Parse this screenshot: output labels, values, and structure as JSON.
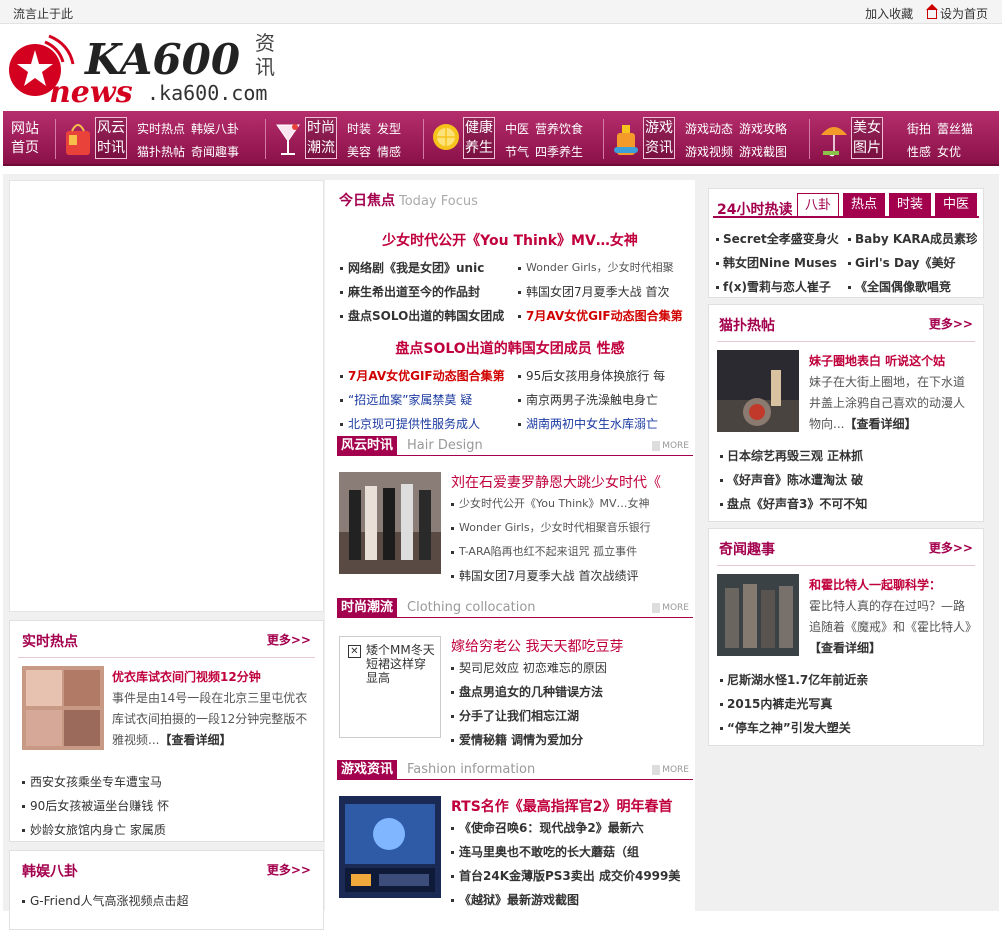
{
  "topbar": {
    "left": "流言止于此",
    "bookmark": "加入收藏",
    "homepage": "设为首页"
  },
  "logo": {
    "brand": "KA600",
    "suffix": "资讯",
    "news": "news",
    "domain": ".ka600.com"
  },
  "nav": {
    "home": "网站首页",
    "cats": [
      {
        "label": "风云时讯",
        "subs": [
          [
            "实时热点",
            "韩娱八卦"
          ],
          [
            "猫扑热帖",
            "奇闻趣事"
          ]
        ]
      },
      {
        "label": "时尚潮流",
        "subs": [
          [
            "时装",
            "发型"
          ],
          [
            "美容",
            "情感"
          ]
        ]
      },
      {
        "label": "健康养生",
        "subs": [
          [
            "中医",
            "营养饮食"
          ],
          [
            "节气",
            "四季养生"
          ]
        ]
      },
      {
        "label": "游戏资讯",
        "subs": [
          [
            "游戏动态",
            "游戏攻略"
          ],
          [
            "游戏视频",
            "游戏截图"
          ]
        ]
      },
      {
        "label": "美女图片",
        "subs": [
          [
            "街拍",
            "蕾丝猫"
          ],
          [
            "性感",
            "女优"
          ]
        ]
      }
    ]
  },
  "left": {
    "realtime": {
      "title": "实时热点",
      "more": "更多>>",
      "feat_title": "优衣库试衣间门视频12分钟",
      "feat_desc": "事件是由14号一段在北京三里屯优衣库试衣间拍摄的一段12分钟完整版不雅视频...",
      "feat_link": "【查看详细】",
      "items": [
        "西安女孩乘坐专车遭宝马",
        "90后女孩被逼坐台赚钱 怀",
        "妙龄女旅馆内身亡 家属质"
      ]
    },
    "korean": {
      "title": "韩娱八卦",
      "more": "更多>>",
      "items": [
        "G-Friend人气高涨视频点击超"
      ]
    }
  },
  "mid": {
    "focus_title": "今日焦点",
    "focus_en": "Today Focus",
    "headline1": "少女时代公开《You Think》MV…女神",
    "grid1": [
      "网络剧《我是女团》unic",
      "Wonder Girls，少女时代相聚",
      "麻生希出道至今的作品封",
      "韩国女团7月夏季大战 首次",
      "盘点SOLO出道的韩国女团成",
      "7月AV女优GIF动态图合集第"
    ],
    "headline2": "盘点SOLO出道的韩国女团成员 性感",
    "grid2": [
      "7月AV女优GIF动态图合集第",
      "95后女孩用身体换旅行 每",
      "“招远血案”家属禁莫 疑",
      "南京两男子洗澡触电身亡",
      "北京现可提供性服务成人",
      "湖南两初中女生水库溺亡"
    ],
    "sec1": {
      "title": "风云时讯",
      "en": "Hair Design",
      "more": "MORE"
    },
    "feat1": {
      "title": "刘在石爱妻罗静恩大跳少女时代《",
      "items": [
        "少女时代公开《You Think》MV…女神",
        "Wonder Girls，少女时代相聚音乐银行",
        "T-ARA陷再也红不起来诅咒 孤立事件",
        "韩国女团7月夏季大战 首次战绩评"
      ]
    },
    "sec2": {
      "title": "时尚潮流",
      "en": "Clothing collocation",
      "more": "MORE"
    },
    "feat2": {
      "broken_alt": "矮个MM冬天短裙这样穿显高",
      "title": "嫁给穷老公 我天天都吃豆芽",
      "items": [
        "契司尼效应 初恋难忘的原因",
        "盘点男追女的几种错误方法",
        "分手了让我们相忘江湖",
        "爱情秘籍 调情为爱加分"
      ]
    },
    "sec3": {
      "title": "游戏资讯",
      "en": "Fashion information",
      "more": "MORE"
    },
    "feat3": {
      "title": "RTS名作《最高指挥官2》明年春首",
      "items": [
        "《使命召唤6：现代战争2》最新六",
        "连马里奥也不敢吃的长大蘑菇（组",
        "首台24K金薄版PS3卖出 成交价4999美",
        "《越狱》最新游戏截图"
      ]
    }
  },
  "right": {
    "hot24": {
      "title": "24小时热读",
      "tabs": [
        "八卦",
        "热点",
        "时装",
        "中医"
      ],
      "items": [
        "Secret全孝盛变身火",
        "Baby KARA成员素珍",
        "韩女团Nine Muses",
        "Girl's Day《美好",
        "f(x)雪莉与恋人崔子",
        "《全国偶像歌唱竞"
      ]
    },
    "maopu": {
      "title": "猫扑热帖",
      "more": "更多>>",
      "feat_title": "妹子圈地表白 听说这个姑",
      "feat_desc": "妹子在大街上圈地，在下水道井盖上涂鸦自己喜欢的动漫人物向...",
      "feat_link": "【查看详细】",
      "items": [
        "日本综艺再毁三观 正林抓",
        "《好声音》陈冰遭淘汰 破",
        "盘点《好声音3》不可不知"
      ]
    },
    "qiwen": {
      "title": "奇闻趣事",
      "more": "更多>>",
      "feat_title": "和霍比特人一起聊科学：",
      "feat_desc": "霍比特人真的存在过吗？—路追随着《魔戒》和《霍比特人》",
      "feat_link": "【查看详细】",
      "items": [
        "尼斯湖水怪1.7亿年前近亲",
        "2015内裤走光写真",
        "“停车之神”引发大塑关"
      ]
    }
  },
  "colors": {
    "accent": "#a3004d",
    "red": "#c0003c",
    "nav_top": "#b52e6d",
    "nav_bottom": "#8a1048"
  }
}
